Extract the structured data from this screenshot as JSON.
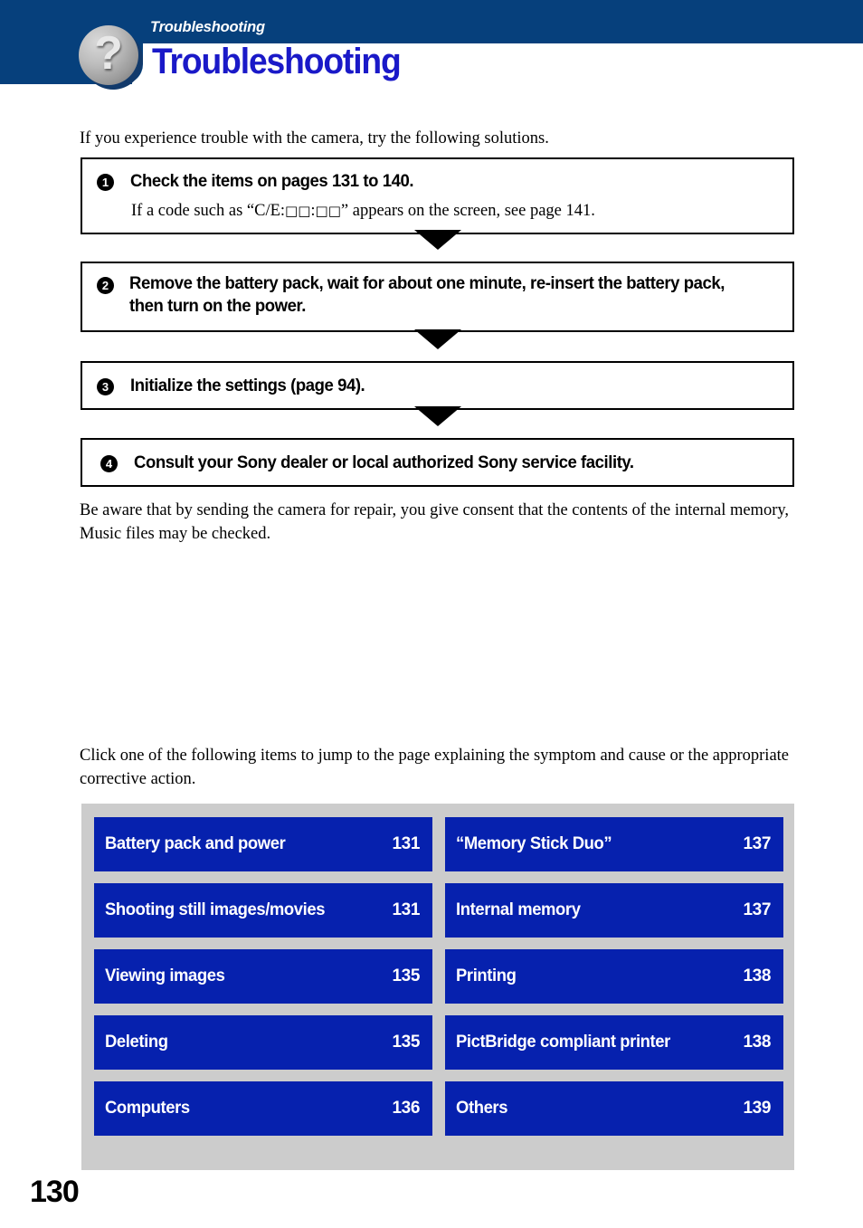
{
  "header": {
    "eyebrow": "Troubleshooting",
    "title": "Troubleshooting",
    "icon": "question-mark-badge-icon",
    "band_color": "#06407c",
    "title_color": "#1a19c8"
  },
  "intro": {
    "text": "If you experience trouble with the camera, try the following solutions."
  },
  "steps": [
    {
      "number": "1",
      "heading": "Check the items on pages 131 to 140.",
      "subtext_before": "If a code such as “C/E:",
      "subtext_boxes_1": "□□",
      "subtext_mid": ":",
      "subtext_boxes_2": "□□",
      "subtext_after": "” appears on the screen, see page 141."
    },
    {
      "number": "2",
      "heading": "Remove the battery pack, wait for about one minute, re-insert the battery pack, then turn on the power."
    },
    {
      "number": "3",
      "heading": "Initialize the settings (page 94)."
    },
    {
      "number": "4",
      "heading": "Consult your Sony dealer or local authorized Sony service facility."
    }
  ],
  "consent": {
    "text": "Be aware that by sending the camera for repair, you give consent that the contents of the internal memory, Music files may be checked."
  },
  "click_instruction": {
    "text": "Click one of the following items to jump to the page explaining the symptom and cause or the appropriate corrective action."
  },
  "link_panel": {
    "background": "#cccccc",
    "button_color": "#0621ae",
    "items": [
      {
        "label": "Battery pack and power",
        "page": "131"
      },
      {
        "label": "“Memory Stick Duo”",
        "page": "137"
      },
      {
        "label": "Shooting still images/movies",
        "page": "131"
      },
      {
        "label": "Internal memory",
        "page": "137"
      },
      {
        "label": "Viewing images",
        "page": "135"
      },
      {
        "label": "Printing",
        "page": "138"
      },
      {
        "label": "Deleting",
        "page": "135"
      },
      {
        "label": "PictBridge compliant printer",
        "page": "138"
      },
      {
        "label": "Computers",
        "page": "136"
      },
      {
        "label": "Others",
        "page": "139"
      }
    ]
  },
  "footer": {
    "page_number": "130"
  }
}
